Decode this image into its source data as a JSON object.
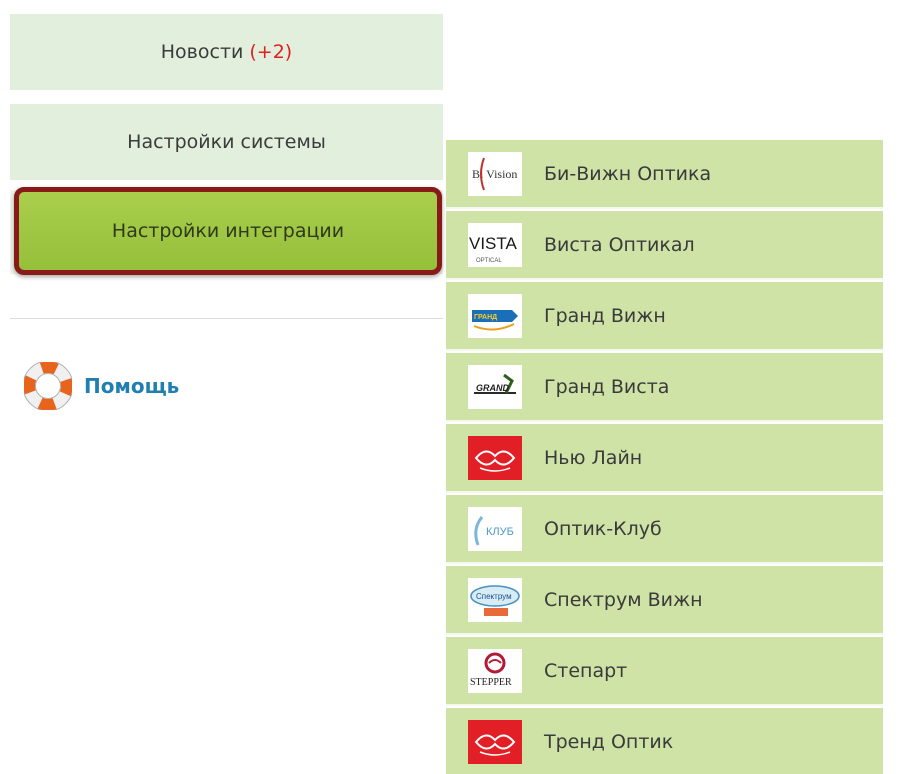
{
  "menu": {
    "news_label": "Новости",
    "news_badge": "(+2)",
    "system_settings_label": "Настройки системы",
    "integration_settings_label": "Настройки интеграции",
    "help_label": "Помощь"
  },
  "submenu": {
    "items": [
      {
        "label": "Би-Вижн Оптика",
        "icon": "bivision-logo"
      },
      {
        "label": "Виста Оптикал",
        "icon": "vista-optical-logo"
      },
      {
        "label": "Гранд Вижн",
        "icon": "grand-vision-logo"
      },
      {
        "label": "Гранд Виста",
        "icon": "grand-vista-logo"
      },
      {
        "label": "Нью Лайн",
        "icon": "new-line-logo"
      },
      {
        "label": "Оптик-Клуб",
        "icon": "optic-club-logo"
      },
      {
        "label": "Спектрум Вижн",
        "icon": "spectrum-vision-logo"
      },
      {
        "label": "Степарт",
        "icon": "stepper-logo"
      },
      {
        "label": "Тренд Оптик",
        "icon": "trend-optic-logo"
      }
    ]
  },
  "logos": {
    "bivision_text": "Bi Vision",
    "vista_text": "VISTA",
    "vista_sub": "OPTICAL",
    "grand_vision_text": "ГРАНД",
    "grand_vista_text": "GRAND",
    "optic_club_text": "КЛУБ",
    "spectrum_text": "Спектрум",
    "stepper_text": "STEPPER"
  },
  "colors": {
    "menu_bg": "#e2efdc",
    "active_bg": "#a9cf4d",
    "active_border": "#8a1a1a",
    "submenu_bg": "#cfe3a7",
    "badge": "#e02020",
    "help_text": "#1f7fb2"
  }
}
